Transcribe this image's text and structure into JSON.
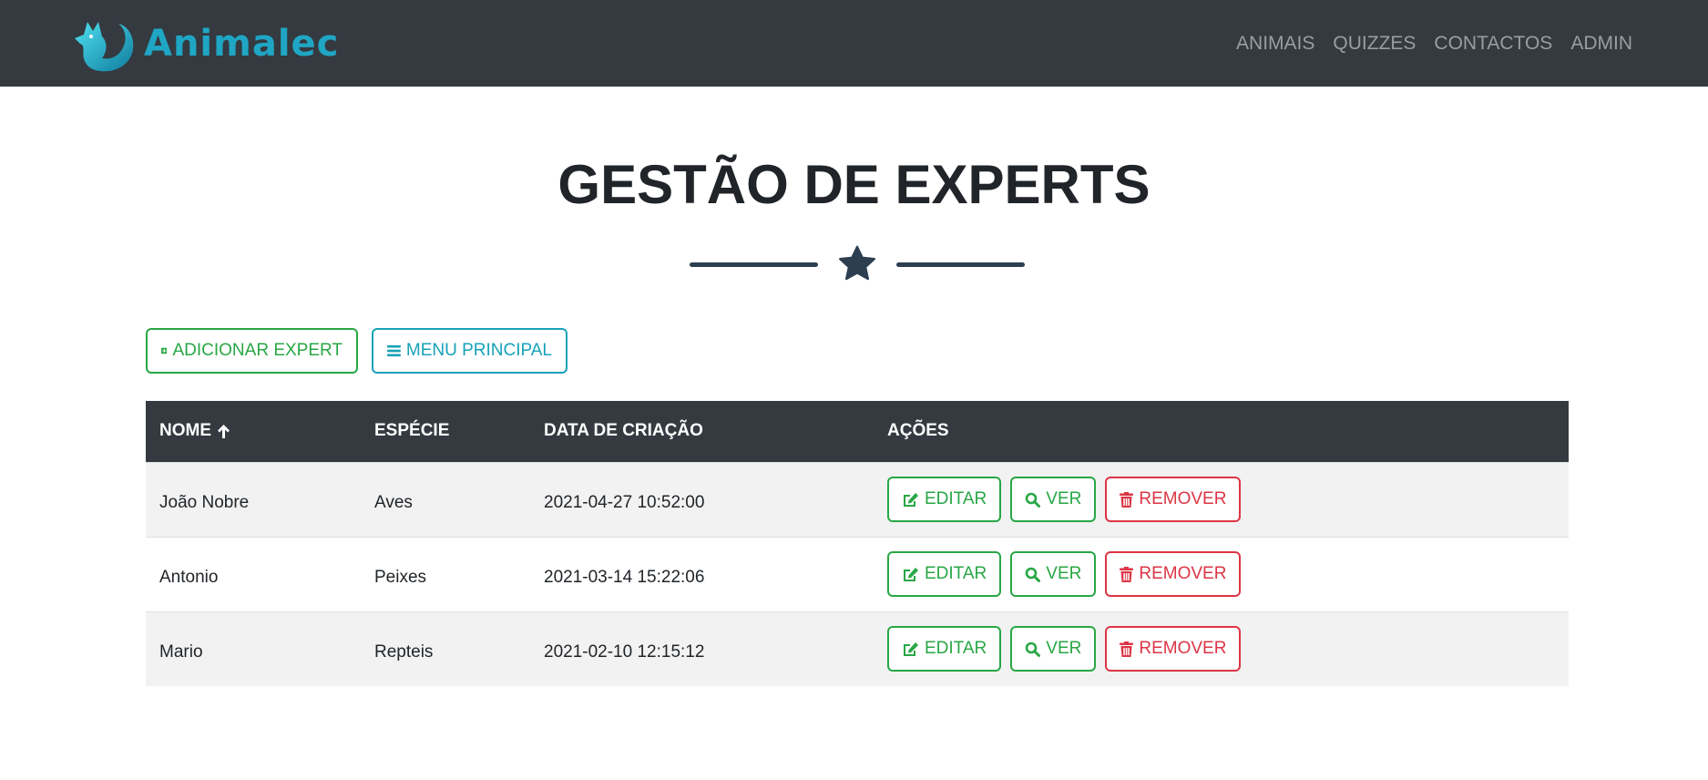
{
  "brand": {
    "name": "Animalec"
  },
  "nav": [
    "ANIMAIS",
    "QUIZZES",
    "CONTACTOS",
    "ADMIN"
  ],
  "page": {
    "title": "GESTÃO DE EXPERTS",
    "divider_icon": "star-icon"
  },
  "toolbar": {
    "add_label": "ADICIONAR EXPERT",
    "menu_label": "MENU PRINCIPAL"
  },
  "table": {
    "headers": {
      "name": "NOME",
      "species": "ESPÉCIE",
      "created": "DATA DE CRIAÇÃO",
      "actions": "AÇÕES"
    },
    "sort": {
      "column": "NOME",
      "direction": "ascending",
      "icon": "arrow-up-icon"
    },
    "rows": [
      {
        "name": "João Nobre",
        "species": "Aves",
        "created": "2021-04-27 10:52:00"
      },
      {
        "name": "Antonio",
        "species": "Peixes",
        "created": "2021-03-14 15:22:06"
      },
      {
        "name": "Mario",
        "species": "Repteis",
        "created": "2021-02-10 12:15:12"
      }
    ],
    "action_labels": {
      "edit": "EDITAR",
      "view": "VER",
      "remove": "REMOVER"
    }
  },
  "colors": {
    "navbar": "#343a40",
    "brand": "#1fa6c4",
    "success": "#28a745",
    "info": "#17a2b8",
    "danger": "#dc3545",
    "accent": "#2c3e50"
  }
}
